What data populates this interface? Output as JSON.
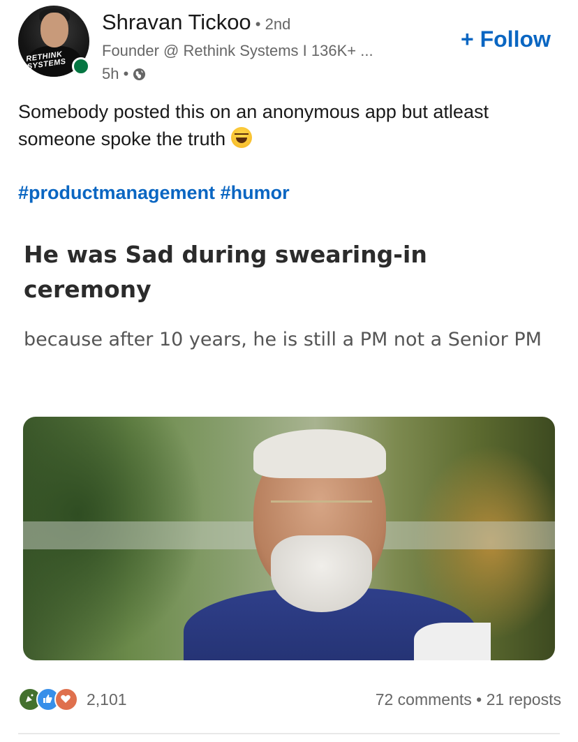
{
  "author": {
    "name": "Shravan Tickoo",
    "degree": " • 2nd",
    "headline": "Founder @ Rethink Systems I 136K+ ...",
    "time": "5h •",
    "avatar_logo_text": "RETHINK\nSYSTEMS"
  },
  "actions": {
    "follow_label": "+ Follow"
  },
  "post": {
    "text": "Somebody posted this on an anonymous app but atleast someone spoke the truth",
    "emoji": "laughing-tears-emoji",
    "hashtags": [
      "#productmanagement",
      "#humor"
    ]
  },
  "meme": {
    "title": "He was Sad during swearing-in ceremony",
    "subtitle": "because after 10 years, he is still a PM not a Senior PM"
  },
  "social": {
    "reactions": [
      "celebrate-icon",
      "like-icon",
      "love-icon"
    ],
    "reaction_count": "2,101",
    "comments_reposts": "72 comments • 21 reposts"
  },
  "colors": {
    "link": "#0a66c2",
    "online": "#057642",
    "muted": "#666666"
  }
}
